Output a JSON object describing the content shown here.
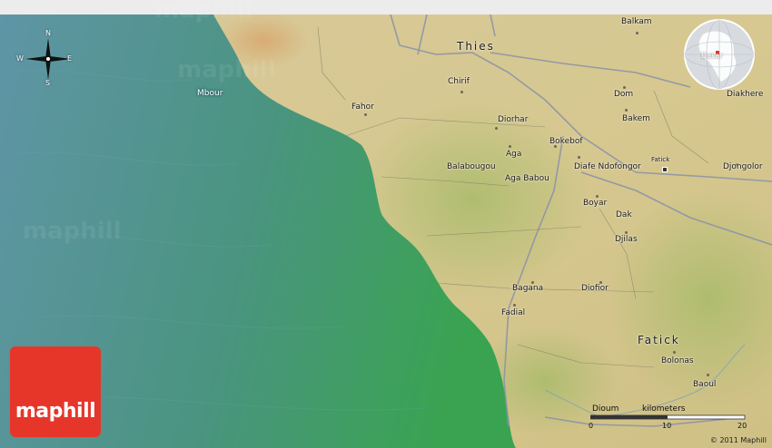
{
  "map": {
    "colors": {
      "sea_deep": "#4f8e98",
      "sea_shallow": "#3fa35f",
      "land": "#d9c796",
      "land_green": "#b9c27a",
      "roads": "#8d94a6"
    },
    "compass": {
      "n": "N",
      "s": "S",
      "e": "E",
      "w": "W"
    },
    "places": [
      {
        "name": "Balkam"
      },
      {
        "name": "Thies"
      },
      {
        "name": "Chirif"
      },
      {
        "name": "Mbour"
      },
      {
        "name": "Fahor"
      },
      {
        "name": "Diorhar"
      },
      {
        "name": "Dom"
      },
      {
        "name": "Diakhere"
      },
      {
        "name": "Bakem"
      },
      {
        "name": "Bokebof"
      },
      {
        "name": "Fatick"
      },
      {
        "name": "Aga"
      },
      {
        "name": "Balabougou"
      },
      {
        "name": "Diafe Ndofongor"
      },
      {
        "name": "Djongolor"
      },
      {
        "name": "Aga Babou"
      },
      {
        "name": "Boyar"
      },
      {
        "name": "Dak"
      },
      {
        "name": "Djilas"
      },
      {
        "name": "Bagana"
      },
      {
        "name": "Diofior"
      },
      {
        "name": "Fadial"
      },
      {
        "name": "Fatick"
      },
      {
        "name": "Bolonas"
      },
      {
        "name": "Baoul"
      }
    ],
    "globe_label": "Dakar",
    "scale": {
      "title": "kilometers",
      "ticks": [
        "0",
        "10",
        "20"
      ],
      "overlap_label": "Dioum"
    },
    "logo": "maphill",
    "watermark": "maphill",
    "copyright": "© 2011 Maphill"
  }
}
